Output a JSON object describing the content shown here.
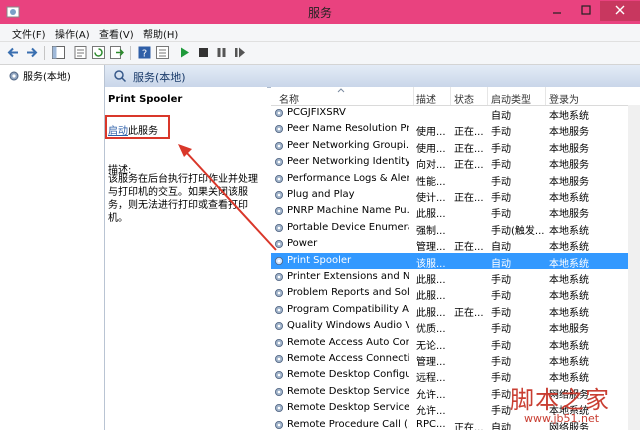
{
  "window": {
    "title": "服务"
  },
  "menu": [
    "文件(F)",
    "操作(A)",
    "查看(V)",
    "帮助(H)"
  ],
  "tree": {
    "root": "服务(本地)"
  },
  "pane": {
    "header": "服务(本地)",
    "selected_service": "Print Spooler",
    "start_link": "启动",
    "start_suffix": "此服务",
    "desc_label": "描述:",
    "description": "该服务在后台执行打印作业并处理与打印机的交互。如果关闭该服务，则无法进行打印或查看打印机。"
  },
  "columns": {
    "name": "名称",
    "desc": "描述",
    "status": "状态",
    "startup": "启动类型",
    "logon": "登录为"
  },
  "services": [
    {
      "name": "PCGJFIXSRV",
      "desc": "",
      "status": "",
      "startup": "自动",
      "logon": "本地系统"
    },
    {
      "name": "Peer Name Resolution Pr...",
      "desc": "使用...",
      "status": "正在...",
      "startup": "手动",
      "logon": "本地服务"
    },
    {
      "name": "Peer Networking Groupi...",
      "desc": "使用...",
      "status": "正在...",
      "startup": "手动",
      "logon": "本地服务"
    },
    {
      "name": "Peer Networking Identity...",
      "desc": "向对...",
      "status": "正在...",
      "startup": "手动",
      "logon": "本地服务"
    },
    {
      "name": "Performance Logs & Aler...",
      "desc": "性能...",
      "status": "",
      "startup": "手动",
      "logon": "本地服务"
    },
    {
      "name": "Plug and Play",
      "desc": "使计...",
      "status": "正在...",
      "startup": "手动",
      "logon": "本地系统"
    },
    {
      "name": "PNRP Machine Name Pu...",
      "desc": "此服...",
      "status": "",
      "startup": "手动",
      "logon": "本地服务"
    },
    {
      "name": "Portable Device Enumera...",
      "desc": "强制...",
      "status": "",
      "startup": "手动(触发...",
      "logon": "本地系统"
    },
    {
      "name": "Power",
      "desc": "管理...",
      "status": "正在...",
      "startup": "自动",
      "logon": "本地系统"
    },
    {
      "name": "Print Spooler",
      "desc": "该服...",
      "status": "",
      "startup": "自动",
      "logon": "本地系统",
      "selected": true
    },
    {
      "name": "Printer Extensions and N...",
      "desc": "此服...",
      "status": "",
      "startup": "手动",
      "logon": "本地系统"
    },
    {
      "name": "Problem Reports and Sol...",
      "desc": "此服...",
      "status": "",
      "startup": "手动",
      "logon": "本地系统"
    },
    {
      "name": "Program Compatibility A...",
      "desc": "此服...",
      "status": "正在...",
      "startup": "手动",
      "logon": "本地系统"
    },
    {
      "name": "Quality Windows Audio V...",
      "desc": "优质...",
      "status": "",
      "startup": "手动",
      "logon": "本地服务"
    },
    {
      "name": "Remote Access Auto Con...",
      "desc": "无论...",
      "status": "",
      "startup": "手动",
      "logon": "本地系统"
    },
    {
      "name": "Remote Access Connecti...",
      "desc": "管理...",
      "status": "",
      "startup": "手动",
      "logon": "本地系统"
    },
    {
      "name": "Remote Desktop Configu...",
      "desc": "远程...",
      "status": "",
      "startup": "手动",
      "logon": "本地系统"
    },
    {
      "name": "Remote Desktop Services",
      "desc": "允许...",
      "status": "",
      "startup": "手动",
      "logon": "网络服务"
    },
    {
      "name": "Remote Desktop Service...",
      "desc": "允许...",
      "status": "",
      "startup": "手动",
      "logon": "本地系统"
    },
    {
      "name": "Remote Procedure Call (...",
      "desc": "RPC...",
      "status": "正在...",
      "startup": "自动",
      "logon": "网络服务"
    }
  ],
  "watermark": {
    "main": "脚本之家",
    "url": "www.jb51.net"
  },
  "colors": {
    "titlebar": "#e9427f",
    "selection": "#3399ff",
    "link": "#2b5ea8",
    "highlight": "#d9372a"
  }
}
